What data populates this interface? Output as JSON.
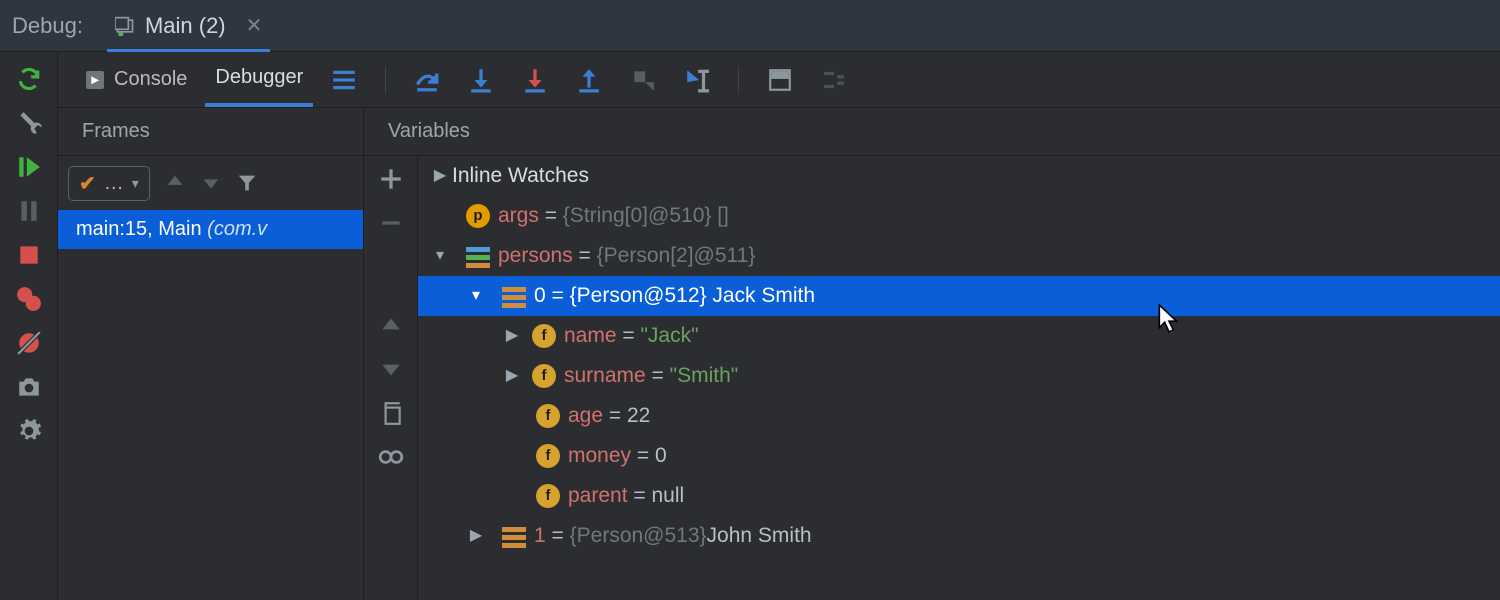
{
  "header": {
    "title": "Debug:",
    "tab_label": "Main (2)"
  },
  "toolbar": {
    "console_label": "Console",
    "debugger_label": "Debugger"
  },
  "frames": {
    "header": "Frames",
    "thread_select": "…",
    "frame_entry": "main:15, Main ",
    "frame_pkg": "(com.v"
  },
  "vars": {
    "header": "Variables",
    "inline_watches_label": "Inline Watches",
    "args": {
      "name": "args",
      "value": "{String[0]@510} []"
    },
    "persons_row": {
      "name": "persons",
      "value": "{Person[2]@511}"
    },
    "person0": {
      "index": "0",
      "value": "{Person@512} Jack Smith",
      "name": {
        "k": "name",
        "v": "\"Jack\""
      },
      "surname": {
        "k": "surname",
        "v": "\"Smith\""
      },
      "age": {
        "k": "age",
        "v": "22"
      },
      "money": {
        "k": "money",
        "v": "0"
      },
      "parent": {
        "k": "parent",
        "v": "null"
      }
    },
    "person1": {
      "index": "1",
      "value_obj": "{Person@513} ",
      "value_name": "John Smith"
    }
  }
}
